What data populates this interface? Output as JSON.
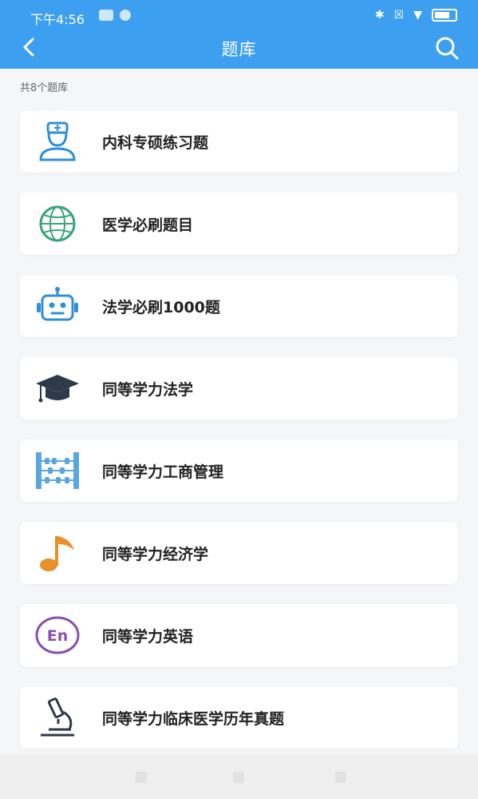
{
  "status_bar": {
    "time": "下午4:56"
  },
  "header": {
    "title": "题库"
  },
  "count_text": "共8个题库",
  "items": [
    {
      "label": "内科专硕练习题",
      "icon": "doctor-icon",
      "color": "#2f8fd8"
    },
    {
      "label": "医学必刷题目",
      "icon": "globe-icon",
      "color": "#3aa57a"
    },
    {
      "label": "法学必刷1000题",
      "icon": "robot-icon",
      "color": "#2f8fd8"
    },
    {
      "label": "同等学力法学",
      "icon": "graduation-cap-icon",
      "color": "#2d3a4a"
    },
    {
      "label": "同等学力工商管理",
      "icon": "abacus-icon",
      "color": "#5aa6e0"
    },
    {
      "label": "同等学力经济学",
      "icon": "music-note-icon",
      "color": "#e8902a"
    },
    {
      "label": "同等学力英语",
      "icon": "english-icon",
      "color": "#8a4fb0"
    },
    {
      "label": "同等学力临床医学历年真题",
      "icon": "microscope-icon",
      "color": "#2d3a4a"
    }
  ],
  "colors": {
    "header_bg": "#3d9ff0",
    "page_bg": "#f5f6f8"
  }
}
